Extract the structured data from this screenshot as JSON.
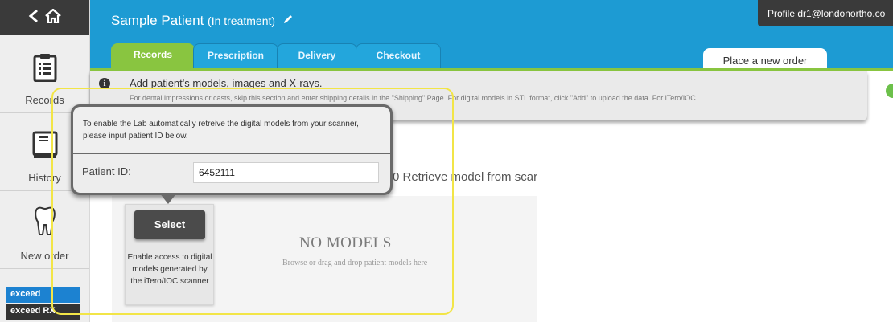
{
  "sidebar": {
    "top_icons": [
      "back-icon",
      "home-icon"
    ],
    "items": [
      {
        "label": "Records",
        "icon": "clipboard-icon"
      },
      {
        "label": "History",
        "icon": "book-icon"
      },
      {
        "label": "New order",
        "icon": "tooth-icon"
      }
    ],
    "brand": {
      "line1": "exceed",
      "line2": "exceed RX"
    }
  },
  "header": {
    "patient_name": "Sample Patient",
    "patient_status": "(In treatment)",
    "profile_text": "Profile  dr1@londonortho.co",
    "tabs": [
      {
        "label": "Records",
        "active": true
      },
      {
        "label": "Prescription",
        "active": false
      },
      {
        "label": "Delivery",
        "active": false
      },
      {
        "label": "Checkout",
        "active": false
      }
    ],
    "place_order_label": "Place a new order",
    "accent_color": "#1d9bd3",
    "active_tab_color": "#89c540"
  },
  "info": {
    "title": "Add patient's models, images and X-rays.",
    "description": "For dental impressions or casts, skip this section and enter shipping details in the \"Shipping\" Page. For digital models in STL format, click \"Add\" to upload the data. For iTero/IOC"
  },
  "retrieve": {
    "text": "0 Retrieve model from scar"
  },
  "popup": {
    "message": "To enable the Lab automatically retreive the digital models from your scanner, please input patient ID below.",
    "label": "Patient ID:",
    "value": "6452111"
  },
  "select_card": {
    "button_label": "Select",
    "description": "Enable access to digital models generated by the iTero/IOC scanner"
  },
  "models": {
    "empty_title": "NO MODELS",
    "empty_hint": "Browse or drag and drop patient models here"
  }
}
